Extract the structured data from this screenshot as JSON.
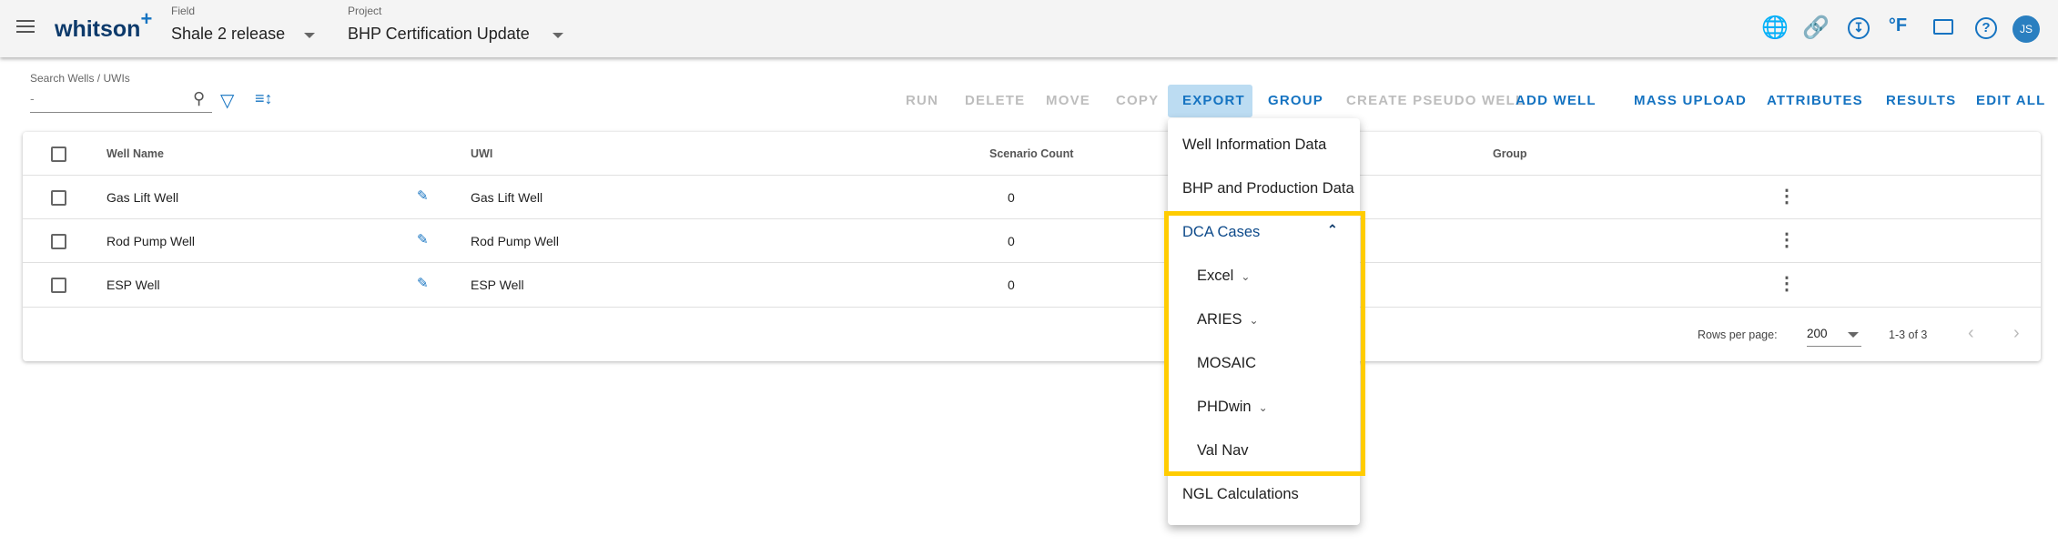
{
  "header": {
    "logo": "whitson",
    "logo_plus": "+",
    "field_label": "Field",
    "field_value": "Shale 2 release",
    "project_label": "Project",
    "project_value": "BHP Certification Update",
    "avatar": "JS",
    "temp_unit": "°F"
  },
  "search": {
    "label": "Search Wells / UWIs",
    "value": "-"
  },
  "toolbar": [
    "RUN",
    "DELETE",
    "MOVE",
    "COPY",
    "EXPORT",
    "GROUP",
    "CREATE PSEUDO WELL",
    "ADD WELL",
    "MASS UPLOAD",
    "ATTRIBUTES",
    "RESULTS",
    "EDIT ALL"
  ],
  "table": {
    "headers": [
      "Well Name",
      "UWI",
      "Scenario Count",
      "Group"
    ],
    "rows": [
      {
        "name": "Gas Lift Well",
        "uwi": "Gas Lift Well",
        "count": "0"
      },
      {
        "name": "Rod Pump Well",
        "uwi": "Rod Pump Well",
        "count": "0"
      },
      {
        "name": "ESP Well",
        "uwi": "ESP Well",
        "count": "0"
      }
    ],
    "rows_per_page_label": "Rows per page:",
    "rows_per_page": "200",
    "range": "1-3 of 3"
  },
  "export_menu": {
    "items": [
      "Well Information Data",
      "BHP and Production Data",
      "DCA Cases",
      "Excel",
      "ARIES",
      "MOSAIC",
      "PHDwin",
      "Val Nav",
      "NGL Calculations"
    ]
  },
  "colors": {
    "accent": "#1573c1",
    "highlight": "#ffcc00"
  }
}
